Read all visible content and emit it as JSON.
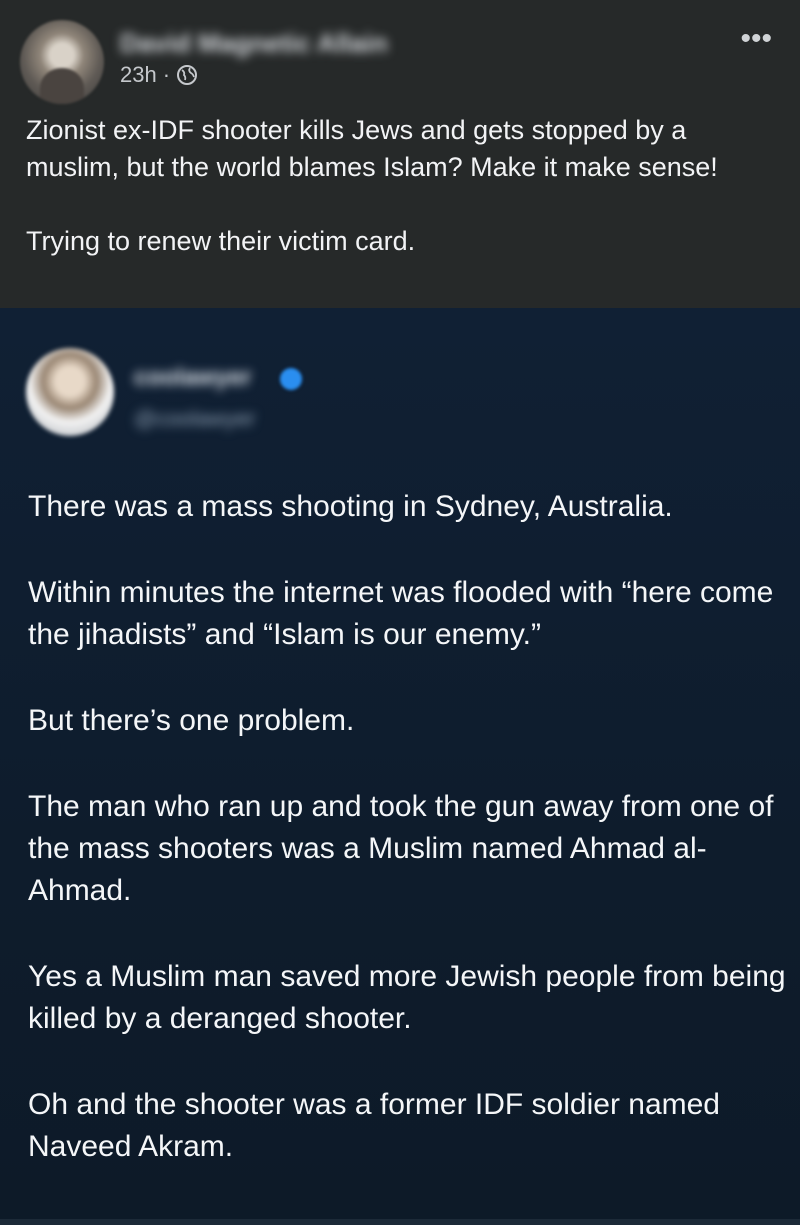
{
  "post": {
    "author_name": "David Magnetic Allain",
    "time": "23h",
    "separator": "·",
    "text_lines": [
      "Zionist ex-IDF shooter kills Jews and gets stopped by a muslim, but the world blames Islam? Make it make sense!",
      "Trying to renew their victim card."
    ],
    "icons": {
      "more": "more-options-icon",
      "privacy": "globe-icon"
    }
  },
  "tweet": {
    "author_name": "coolawyer",
    "handle": "@coolawyer",
    "paragraphs": [
      "There was a mass shooting in Sydney, Australia.",
      "Within minutes the internet was flooded with “here come the jihadists” and “Islam is our enemy.”",
      "But there’s one problem.",
      "The man who ran up and took the gun away from one of the mass shooters was a Muslim named Ahmad al-Ahmad.",
      "Yes a Muslim man saved more Jewish people from being killed by a deranged shooter.",
      "Oh and the shooter was a former IDF soldier named Naveed Akram."
    ],
    "colors": {
      "verified": "#2a8ef0",
      "background": "#0f1b2a"
    }
  }
}
